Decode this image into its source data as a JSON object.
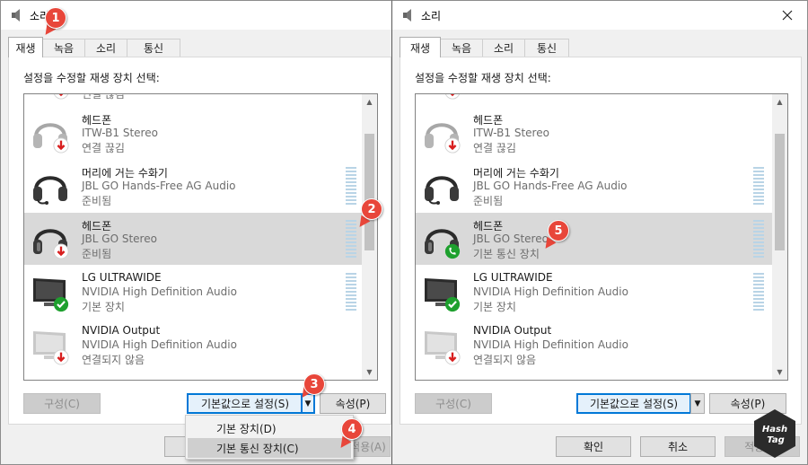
{
  "windows": [
    {
      "title": "소리",
      "tabs": [
        "재생",
        "녹음",
        "소리",
        "통신"
      ],
      "instruction": "설정을 수정할 재생 장치 선택:",
      "cut_off_item_status": "연결 끊김",
      "devices": [
        {
          "name": "헤드폰",
          "sub": "ITW-B1 Stereo",
          "status": "연결 끊김",
          "icon": "headphones-disconnected-icon"
        },
        {
          "name": "머리에 거는 수화기",
          "sub": "JBL GO Hands-Free AG Audio",
          "status": "준비됨",
          "icon": "headset-icon"
        },
        {
          "name": "헤드폰",
          "sub": "JBL GO Stereo",
          "status": "준비됨",
          "icon": "headphones-disconnected-icon"
        },
        {
          "name": "LG ULTRAWIDE",
          "sub": "NVIDIA High Definition Audio",
          "status": "기본 장치",
          "icon": "monitor-default-icon"
        },
        {
          "name": "NVIDIA Output",
          "sub": "NVIDIA High Definition Audio",
          "status": "연결되지 않음",
          "icon": "monitor-disconnected-icon"
        }
      ],
      "buttons": {
        "configure": "구성(C)",
        "set_default": "기본값으로 설정(S)",
        "properties": "속성(P)",
        "apply": "적용(A)"
      },
      "dropdown": [
        "기본 장치(D)",
        "기본 통신 장치(C)"
      ],
      "badges": [
        "1",
        "2",
        "3",
        "4"
      ]
    },
    {
      "title": "소리",
      "tabs": [
        "재생",
        "녹음",
        "소리",
        "통신"
      ],
      "instruction": "설정을 수정할 재생 장치 선택:",
      "devices": [
        {
          "name": "헤드폰",
          "sub": "ITW-B1 Stereo",
          "status": "연결 끊김",
          "icon": "headphones-disconnected-icon"
        },
        {
          "name": "머리에 거는 수화기",
          "sub": "JBL GO Hands-Free AG Audio",
          "status": "준비됨",
          "icon": "headset-icon"
        },
        {
          "name": "헤드폰",
          "sub": "JBL GO Stereo",
          "status": "기본 통신 장치",
          "icon": "headphones-communication-icon"
        },
        {
          "name": "LG ULTRAWIDE",
          "sub": "NVIDIA High Definition Audio",
          "status": "기본 장치",
          "icon": "monitor-default-icon"
        },
        {
          "name": "NVIDIA Output",
          "sub": "NVIDIA High Definition Audio",
          "status": "연결되지 않음",
          "icon": "monitor-disconnected-icon"
        }
      ],
      "buttons": {
        "configure": "구성(C)",
        "set_default": "기본값으로 설정(S)",
        "properties": "속성(P)",
        "ok": "확인",
        "cancel": "취소",
        "apply": "적용(A)"
      },
      "badges": [
        "5"
      ]
    }
  ],
  "logo": {
    "line1": "Hash",
    "line2": "Tag"
  },
  "colors": {
    "accent": "#0078d7",
    "badge": "#e8463a",
    "selected_row": "#d9d9d9",
    "ok_green": "#1ea02e",
    "error_red": "#d81e1e"
  }
}
